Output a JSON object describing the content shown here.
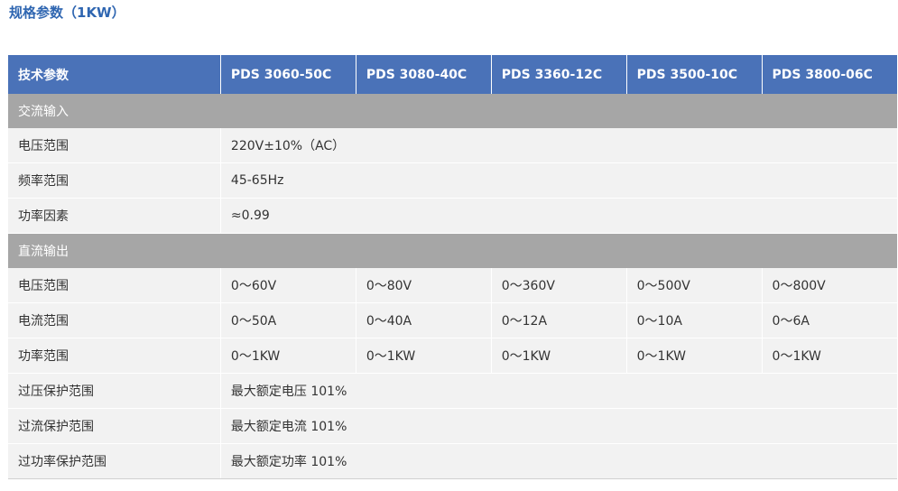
{
  "page_title": "规格参数（1KW）",
  "table": {
    "header": [
      "技术参数",
      "PDS 3060-50C",
      "PDS 3080-40C",
      "PDS 3360-12C",
      "PDS 3500-10C",
      "PDS 3800-06C"
    ],
    "sections": [
      {
        "title": "交流输入",
        "rows": [
          {
            "label": "电压范围",
            "value": "220V±10%（AC）"
          },
          {
            "label": "频率范围",
            "value": "45-65Hz"
          },
          {
            "label": "功率因素",
            "value": "≈0.99"
          }
        ]
      },
      {
        "title": "直流输出",
        "rows": [
          {
            "label": "电压范围",
            "values": [
              "0～60V",
              "0～80V",
              "0～360V",
              "0～500V",
              "0～800V"
            ]
          },
          {
            "label": "电流范围",
            "values": [
              "0～50A",
              "0～40A",
              "0～12A",
              "0～10A",
              "0～6A"
            ]
          },
          {
            "label": "功率范围",
            "values": [
              "0～1KW",
              "0～1KW",
              "0～1KW",
              "0～1KW",
              "0～1KW"
            ]
          },
          {
            "label": "过压保护范围",
            "value": "最大额定电压 101%"
          },
          {
            "label": "过流保护范围",
            "value": "最大额定电流 101%"
          },
          {
            "label": "过功率保护范围",
            "value": "最大额定功率 101%"
          }
        ]
      }
    ]
  }
}
